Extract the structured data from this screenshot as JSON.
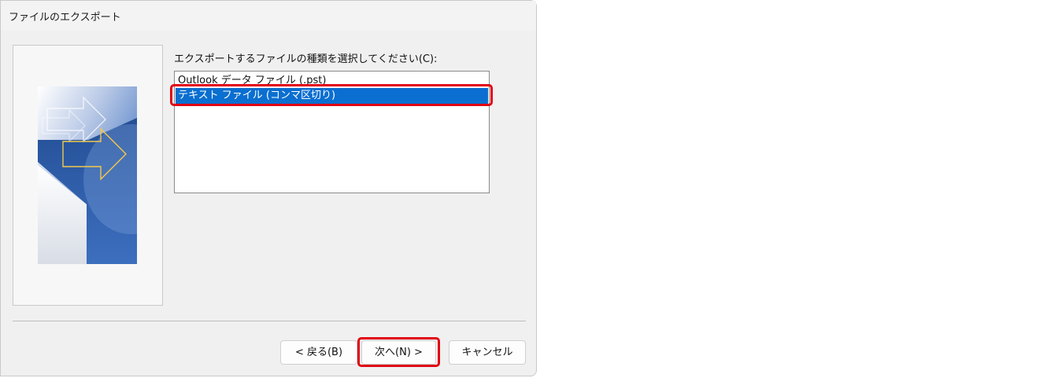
{
  "window": {
    "title": "ファイルのエクスポート"
  },
  "main": {
    "prompt": "エクスポートするファイルの種類を選択してください(C):",
    "file_types": [
      "Outlook データ ファイル (.pst)",
      "テキスト ファイル (コンマ区切り)"
    ],
    "selected_index": 1
  },
  "buttons": {
    "back": "< 戻る(B)",
    "next": "次へ(N) >",
    "cancel": "キャンセル"
  },
  "colors": {
    "selection": "#0a6fd0",
    "annotation_red": "#e10012",
    "art_blue": "#2f5fa8"
  },
  "icons": {
    "wizard_art": "export-wizard-arrows-illustration"
  }
}
